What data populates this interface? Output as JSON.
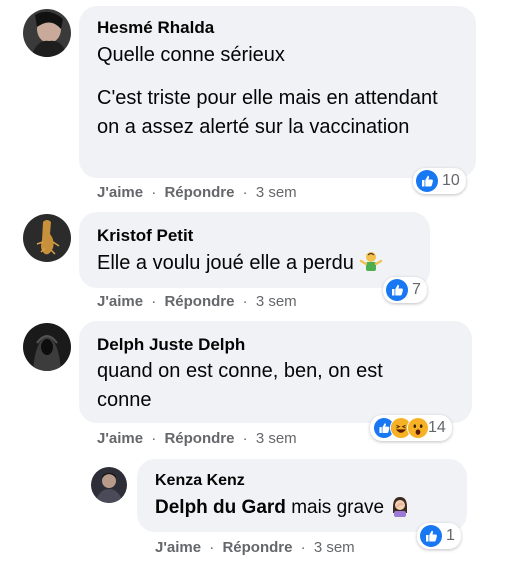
{
  "comments": [
    {
      "author": "Hesmé Rhalda",
      "paragraphs": [
        "Quelle conne sérieux",
        "C'est triste pour elle mais en attendant on a assez alerté sur la vaccination"
      ],
      "like_label": "J'aime",
      "reply_label": "Répondre",
      "separator": "·",
      "time": "3 sem",
      "reaction_count": "10",
      "reaction_types": [
        "like"
      ]
    },
    {
      "author": "Kristof Petit",
      "text": "Elle a voulu joué elle a perdu",
      "emoji": "man-shrugging-emoji",
      "like_label": "J'aime",
      "reply_label": "Répondre",
      "separator": "·",
      "time": "3 sem",
      "reaction_count": "7",
      "reaction_types": [
        "like"
      ]
    },
    {
      "author": "Delph Juste Delph",
      "text": "quand on est conne, ben, on est conne",
      "like_label": "J'aime",
      "reply_label": "Répondre",
      "separator": "·",
      "time": "3 sem",
      "reaction_count": "14",
      "reaction_types": [
        "like",
        "haha",
        "wow"
      ]
    }
  ],
  "reply": {
    "author": "Kenza Kenz",
    "mention": "Delph du Gard",
    "text": "mais grave",
    "emoji": "woman-facepalming-emoji",
    "like_label": "J'aime",
    "reply_label": "Répondre",
    "separator": "·",
    "time": "3 sem",
    "reaction_count": "1",
    "reaction_types": [
      "like"
    ]
  },
  "colors": {
    "bubble": "#f0f2f5",
    "like_blue": "#1877f2",
    "secondary_text": "#65676b",
    "haha_yellow": "#f7b125"
  }
}
